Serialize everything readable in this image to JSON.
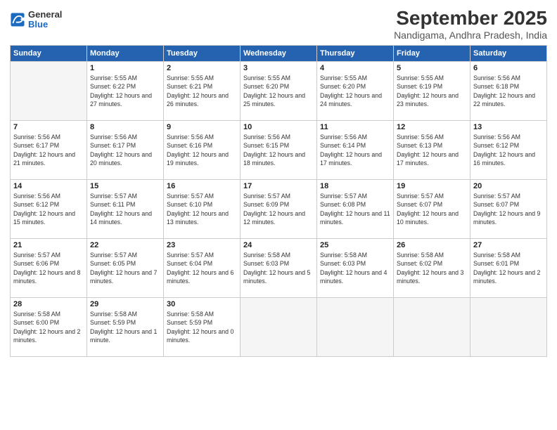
{
  "header": {
    "logo_line1": "General",
    "logo_line2": "Blue",
    "title": "September 2025",
    "subtitle": "Nandigama, Andhra Pradesh, India"
  },
  "calendar": {
    "weekdays": [
      "Sunday",
      "Monday",
      "Tuesday",
      "Wednesday",
      "Thursday",
      "Friday",
      "Saturday"
    ],
    "weeks": [
      [
        {
          "day": "",
          "sunrise": "",
          "sunset": "",
          "daylight": "",
          "empty": true
        },
        {
          "day": "1",
          "sunrise": "Sunrise: 5:55 AM",
          "sunset": "Sunset: 6:22 PM",
          "daylight": "Daylight: 12 hours and 27 minutes."
        },
        {
          "day": "2",
          "sunrise": "Sunrise: 5:55 AM",
          "sunset": "Sunset: 6:21 PM",
          "daylight": "Daylight: 12 hours and 26 minutes."
        },
        {
          "day": "3",
          "sunrise": "Sunrise: 5:55 AM",
          "sunset": "Sunset: 6:20 PM",
          "daylight": "Daylight: 12 hours and 25 minutes."
        },
        {
          "day": "4",
          "sunrise": "Sunrise: 5:55 AM",
          "sunset": "Sunset: 6:20 PM",
          "daylight": "Daylight: 12 hours and 24 minutes."
        },
        {
          "day": "5",
          "sunrise": "Sunrise: 5:55 AM",
          "sunset": "Sunset: 6:19 PM",
          "daylight": "Daylight: 12 hours and 23 minutes."
        },
        {
          "day": "6",
          "sunrise": "Sunrise: 5:56 AM",
          "sunset": "Sunset: 6:18 PM",
          "daylight": "Daylight: 12 hours and 22 minutes."
        }
      ],
      [
        {
          "day": "7",
          "sunrise": "Sunrise: 5:56 AM",
          "sunset": "Sunset: 6:17 PM",
          "daylight": "Daylight: 12 hours and 21 minutes."
        },
        {
          "day": "8",
          "sunrise": "Sunrise: 5:56 AM",
          "sunset": "Sunset: 6:17 PM",
          "daylight": "Daylight: 12 hours and 20 minutes."
        },
        {
          "day": "9",
          "sunrise": "Sunrise: 5:56 AM",
          "sunset": "Sunset: 6:16 PM",
          "daylight": "Daylight: 12 hours and 19 minutes."
        },
        {
          "day": "10",
          "sunrise": "Sunrise: 5:56 AM",
          "sunset": "Sunset: 6:15 PM",
          "daylight": "Daylight: 12 hours and 18 minutes."
        },
        {
          "day": "11",
          "sunrise": "Sunrise: 5:56 AM",
          "sunset": "Sunset: 6:14 PM",
          "daylight": "Daylight: 12 hours and 17 minutes."
        },
        {
          "day": "12",
          "sunrise": "Sunrise: 5:56 AM",
          "sunset": "Sunset: 6:13 PM",
          "daylight": "Daylight: 12 hours and 17 minutes."
        },
        {
          "day": "13",
          "sunrise": "Sunrise: 5:56 AM",
          "sunset": "Sunset: 6:12 PM",
          "daylight": "Daylight: 12 hours and 16 minutes."
        }
      ],
      [
        {
          "day": "14",
          "sunrise": "Sunrise: 5:56 AM",
          "sunset": "Sunset: 6:12 PM",
          "daylight": "Daylight: 12 hours and 15 minutes."
        },
        {
          "day": "15",
          "sunrise": "Sunrise: 5:57 AM",
          "sunset": "Sunset: 6:11 PM",
          "daylight": "Daylight: 12 hours and 14 minutes."
        },
        {
          "day": "16",
          "sunrise": "Sunrise: 5:57 AM",
          "sunset": "Sunset: 6:10 PM",
          "daylight": "Daylight: 12 hours and 13 minutes."
        },
        {
          "day": "17",
          "sunrise": "Sunrise: 5:57 AM",
          "sunset": "Sunset: 6:09 PM",
          "daylight": "Daylight: 12 hours and 12 minutes."
        },
        {
          "day": "18",
          "sunrise": "Sunrise: 5:57 AM",
          "sunset": "Sunset: 6:08 PM",
          "daylight": "Daylight: 12 hours and 11 minutes."
        },
        {
          "day": "19",
          "sunrise": "Sunrise: 5:57 AM",
          "sunset": "Sunset: 6:07 PM",
          "daylight": "Daylight: 12 hours and 10 minutes."
        },
        {
          "day": "20",
          "sunrise": "Sunrise: 5:57 AM",
          "sunset": "Sunset: 6:07 PM",
          "daylight": "Daylight: 12 hours and 9 minutes."
        }
      ],
      [
        {
          "day": "21",
          "sunrise": "Sunrise: 5:57 AM",
          "sunset": "Sunset: 6:06 PM",
          "daylight": "Daylight: 12 hours and 8 minutes."
        },
        {
          "day": "22",
          "sunrise": "Sunrise: 5:57 AM",
          "sunset": "Sunset: 6:05 PM",
          "daylight": "Daylight: 12 hours and 7 minutes."
        },
        {
          "day": "23",
          "sunrise": "Sunrise: 5:57 AM",
          "sunset": "Sunset: 6:04 PM",
          "daylight": "Daylight: 12 hours and 6 minutes."
        },
        {
          "day": "24",
          "sunrise": "Sunrise: 5:58 AM",
          "sunset": "Sunset: 6:03 PM",
          "daylight": "Daylight: 12 hours and 5 minutes."
        },
        {
          "day": "25",
          "sunrise": "Sunrise: 5:58 AM",
          "sunset": "Sunset: 6:03 PM",
          "daylight": "Daylight: 12 hours and 4 minutes."
        },
        {
          "day": "26",
          "sunrise": "Sunrise: 5:58 AM",
          "sunset": "Sunset: 6:02 PM",
          "daylight": "Daylight: 12 hours and 3 minutes."
        },
        {
          "day": "27",
          "sunrise": "Sunrise: 5:58 AM",
          "sunset": "Sunset: 6:01 PM",
          "daylight": "Daylight: 12 hours and 2 minutes."
        }
      ],
      [
        {
          "day": "28",
          "sunrise": "Sunrise: 5:58 AM",
          "sunset": "Sunset: 6:00 PM",
          "daylight": "Daylight: 12 hours and 2 minutes."
        },
        {
          "day": "29",
          "sunrise": "Sunrise: 5:58 AM",
          "sunset": "Sunset: 5:59 PM",
          "daylight": "Daylight: 12 hours and 1 minute."
        },
        {
          "day": "30",
          "sunrise": "Sunrise: 5:58 AM",
          "sunset": "Sunset: 5:59 PM",
          "daylight": "Daylight: 12 hours and 0 minutes."
        },
        {
          "day": "",
          "sunrise": "",
          "sunset": "",
          "daylight": "",
          "empty": true
        },
        {
          "day": "",
          "sunrise": "",
          "sunset": "",
          "daylight": "",
          "empty": true
        },
        {
          "day": "",
          "sunrise": "",
          "sunset": "",
          "daylight": "",
          "empty": true
        },
        {
          "day": "",
          "sunrise": "",
          "sunset": "",
          "daylight": "",
          "empty": true
        }
      ]
    ]
  }
}
